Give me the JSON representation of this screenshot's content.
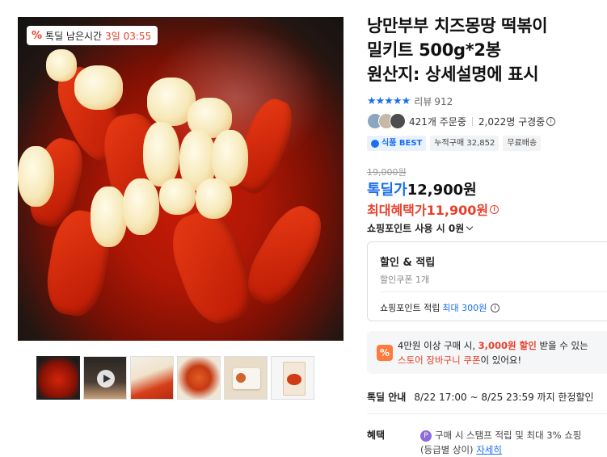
{
  "product": {
    "title_line1": "낭만부부 치즈몽땅 떡볶이",
    "title_line2": "밀키트 500g*2봉",
    "title_line3": "원산지: 상세설명에 표시",
    "rating_stars": "★★★★★",
    "review_label": "리뷰",
    "review_count": "912",
    "order_count": "421개 주문중",
    "subscribers": "2,022명 구경중",
    "tags": [
      "식품 BEST",
      "누적구매 32,852",
      "무료배송"
    ]
  },
  "timer": {
    "label": "톡딜 남은시간",
    "value": "3일 03:55"
  },
  "price": {
    "original": "19,000원",
    "sale_label": "톡딜가",
    "sale_price": "12,900원",
    "max_label": "최대혜택가",
    "max_price": "11,900원",
    "point_use": "쇼핑포인트 사용 시 0원"
  },
  "benefit_box": {
    "title": "할인 & 적립",
    "coupon": "할인쿠폰 1개",
    "points_prefix": "쇼핑포인트 적립",
    "points_highlight": "최대 300원"
  },
  "promo": {
    "line1_prefix": "4만원 이상 구매 시,",
    "line1_red": "3,000원 할인",
    "line1_suffix": "받을 수 있는",
    "line2_red": "스토어 장바구니 쿠폰",
    "line2_suffix": "이 있어요!"
  },
  "deal": {
    "label": "톡딜 안내",
    "text": "8/22 17:00 ~ 8/25 23:59 까지 한정할인"
  },
  "benefit": {
    "label": "혜택",
    "line1": "구매 시 스탬프 적립 및 최대 3% 쇼핑",
    "line2": "(등급별 상이)",
    "link": "자세히"
  },
  "icons": {
    "timer": "percent-icon",
    "play": "play-icon",
    "info": "info-icon"
  },
  "colors": {
    "accent_blue": "#1b6ef3",
    "accent_red": "#e8402b",
    "promo_orange": "#ff7a3d"
  }
}
